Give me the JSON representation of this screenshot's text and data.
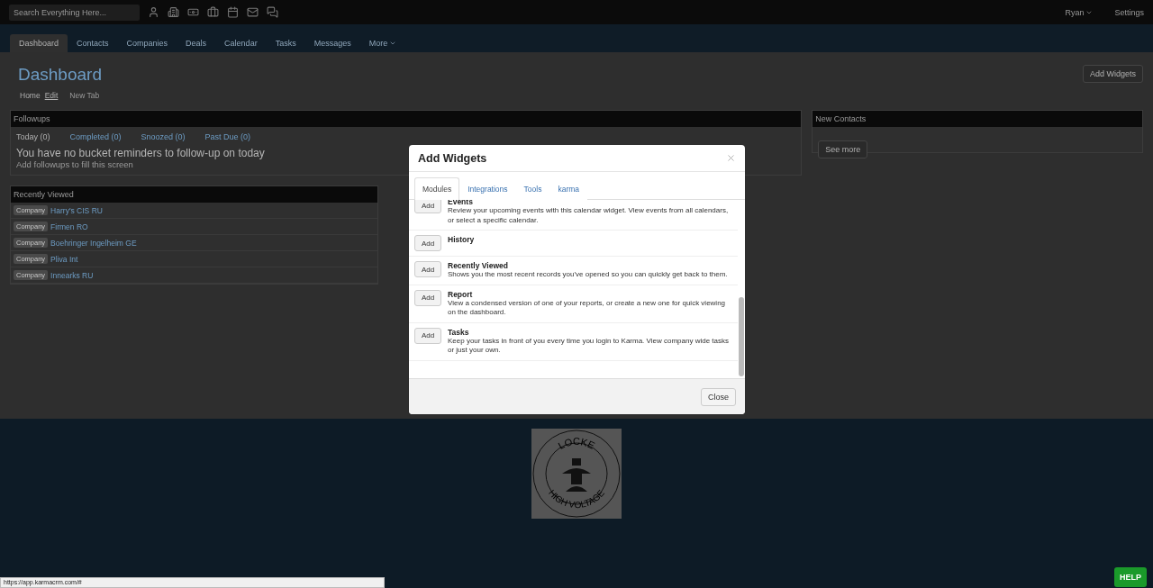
{
  "top_bar": {
    "search": {
      "placeholder": "Search Everything Here..."
    },
    "user_menu": "Ryan",
    "settings": "Settings"
  },
  "nav": {
    "tabs": [
      {
        "label": "Dashboard",
        "selected": true,
        "dropdown": false
      },
      {
        "label": "Contacts",
        "selected": false,
        "dropdown": false
      },
      {
        "label": "Companies",
        "selected": false,
        "dropdown": false
      },
      {
        "label": "Deals",
        "selected": false,
        "dropdown": false
      },
      {
        "label": "Calendar",
        "selected": false,
        "dropdown": false
      },
      {
        "label": "Tasks",
        "selected": false,
        "dropdown": false
      },
      {
        "label": "Messages",
        "selected": false,
        "dropdown": false
      },
      {
        "label": "More",
        "selected": false,
        "dropdown": true
      }
    ]
  },
  "page": {
    "title": "Dashboard",
    "breadcrumbs": [
      {
        "label": "Home",
        "kind": "text"
      },
      {
        "label": "Edit",
        "kind": "link"
      },
      {
        "label": "New Tab",
        "kind": "muted"
      }
    ],
    "add_widgets_button": "Add Widgets"
  },
  "followups": {
    "title": "Followups",
    "tabs": [
      {
        "label": "Today (0)",
        "selected": true
      },
      {
        "label": "Completed (0)",
        "selected": false
      },
      {
        "label": "Snoozed (0)",
        "selected": false
      },
      {
        "label": "Past Due (0)",
        "selected": false
      }
    ],
    "message": "You have no bucket reminders to follow-up on today",
    "hint": "Add followups to fill this screen"
  },
  "new_contacts": {
    "title": "New Contacts",
    "button": "See more"
  },
  "recently_viewed": {
    "title": "Recently Viewed",
    "items": [
      {
        "badge": "Company",
        "name": "Harry's CIS RU"
      },
      {
        "badge": "Company",
        "name": "Firmen RO"
      },
      {
        "badge": "Company",
        "name": "Boehringer Ingelheim GE"
      },
      {
        "badge": "Company",
        "name": "Pliva Int"
      },
      {
        "badge": "Company",
        "name": "Innearks RU"
      }
    ]
  },
  "modal": {
    "title": "Add Widgets",
    "tabs": [
      {
        "label": "Modules",
        "selected": true
      },
      {
        "label": "Integrations",
        "selected": false
      },
      {
        "label": "Tools",
        "selected": false
      },
      {
        "label": "karma",
        "selected": false
      }
    ],
    "widgets": [
      {
        "name": "Events",
        "description": "Review your upcoming events with this calendar widget. View events from all calendars, or select a specific calendar.",
        "button": "Add"
      },
      {
        "name": "History",
        "button": "Add"
      },
      {
        "name": "Recently Viewed",
        "description": "Shows you the most recent records you've opened so you can quickly get back to them.",
        "button": "Add"
      },
      {
        "name": "Report",
        "description": "View a condensed version of one of your reports, or create a new one for quick viewing on the dashboard.",
        "button": "Add"
      },
      {
        "name": "Tasks",
        "description": "Keep your tasks in front of you every time you login to Karma. View company wide tasks or just your own.",
        "button": "Add"
      }
    ],
    "close_button": "Close"
  },
  "footer": {
    "logo": {
      "top_text": "LOCKE",
      "bottom_text": "HIGH VOLTAGE"
    }
  },
  "status_bar": {
    "url": "https://app.karmacrm.com/#"
  },
  "help_button": "HELP"
}
